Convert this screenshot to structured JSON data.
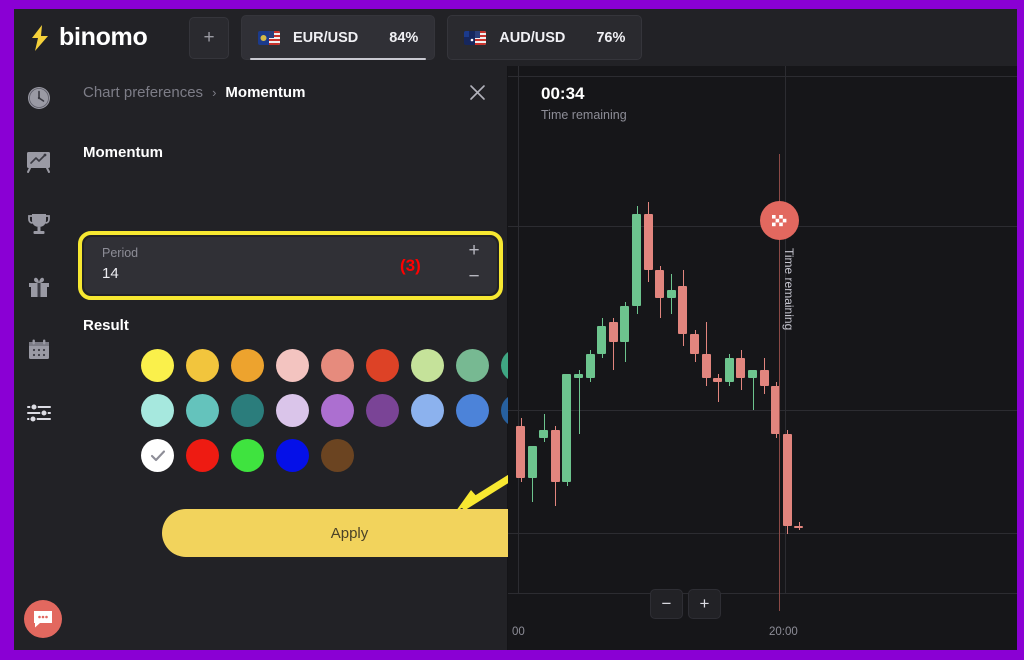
{
  "theme": {
    "frame_color": "#8A00D4",
    "panel_bg": "#222226",
    "chart_bg": "#161619",
    "highlight_yellow": "#F7E831",
    "apply_yellow": "#F2D35C",
    "annotation_red": "#FF0000",
    "bull_green": "#6DC48E",
    "bear_red": "#E2857E"
  },
  "topbar": {
    "logo_text": "binomo",
    "add_tab_label": "+",
    "tabs": [
      {
        "name": "EUR/USD",
        "pct": "84%",
        "active": true,
        "flag": "eu-us-flag-icon"
      },
      {
        "name": "AUD/USD",
        "pct": "76%",
        "active": false,
        "flag": "au-us-flag-icon"
      }
    ]
  },
  "rail": {
    "items": [
      {
        "icon": "clock-icon",
        "name": "sidebar-item-history"
      },
      {
        "icon": "chart-board-icon",
        "name": "sidebar-item-strategies"
      },
      {
        "icon": "trophy-icon",
        "name": "sidebar-item-tournaments"
      },
      {
        "icon": "gift-icon",
        "name": "sidebar-item-gifts"
      },
      {
        "icon": "calendar-icon",
        "name": "sidebar-item-calendar"
      },
      {
        "icon": "sliders-icon",
        "name": "sidebar-item-settings"
      }
    ],
    "chat_icon": "chat-bubble-icon"
  },
  "panel": {
    "breadcrumb_root": "Chart preferences",
    "breadcrumb_sep": "›",
    "breadcrumb_current": "Momentum",
    "close_icon": "close-icon",
    "section_title": "Momentum",
    "period": {
      "label": "Period",
      "value": "14",
      "annotation": "(3)",
      "increment_label": "+",
      "decrement_label": "−"
    },
    "result_title": "Result",
    "swatches": [
      {
        "color": "#FAF04B",
        "selected": false
      },
      {
        "color": "#F2C53D",
        "selected": false
      },
      {
        "color": "#EDA32E",
        "selected": false
      },
      {
        "color": "#F3C4C0",
        "selected": false
      },
      {
        "color": "#E68B7D",
        "selected": false
      },
      {
        "color": "#DD4226",
        "selected": false
      },
      {
        "color": "#C5E29A",
        "selected": false
      },
      {
        "color": "#77B992",
        "selected": false
      },
      {
        "color": "#3FA783",
        "selected": false
      },
      {
        "color": "#A6E8DE",
        "selected": false
      },
      {
        "color": "#64C3BC",
        "selected": false
      },
      {
        "color": "#2B7D7C",
        "selected": false
      },
      {
        "color": "#DAC5EA",
        "selected": false
      },
      {
        "color": "#AC6FD0",
        "selected": false
      },
      {
        "color": "#7A4496",
        "selected": false
      },
      {
        "color": "#8CB2EE",
        "selected": false
      },
      {
        "color": "#4C83D9",
        "selected": false
      },
      {
        "color": "#27609F",
        "selected": false
      },
      {
        "color": "#FFFFFF",
        "selected": true
      },
      {
        "color": "#EE1B12",
        "selected": false
      },
      {
        "color": "#3FE33F",
        "selected": false
      },
      {
        "color": "#0510E8",
        "selected": false
      },
      {
        "color": "#6B4421",
        "selected": false
      }
    ],
    "apply_label": "Apply",
    "arrow_annotation": "arrow-pointing-to-apply"
  },
  "chart_data": {
    "type": "candlestick",
    "title": "",
    "timer_value": "00:34",
    "timer_label": "Time remaining",
    "deal_marker_icon": "checkered-flag-icon",
    "deal_caption": "Time remaining",
    "xlabel": "",
    "ylabel": "",
    "grid": true,
    "x_tick_labels": [
      "00",
      "20:00"
    ],
    "zoom_out_label": "−",
    "zoom_in_label": "+",
    "candles": [
      {
        "o": 60,
        "h": 62,
        "l": 46,
        "c": 47,
        "dir": "down"
      },
      {
        "o": 47,
        "h": 49,
        "l": 41,
        "c": 55,
        "dir": "up"
      },
      {
        "o": 57,
        "h": 63,
        "l": 56,
        "c": 59,
        "dir": "up"
      },
      {
        "o": 59,
        "h": 60,
        "l": 40,
        "c": 46,
        "dir": "down"
      },
      {
        "o": 46,
        "h": 73,
        "l": 45,
        "c": 73,
        "dir": "up"
      },
      {
        "o": 73,
        "h": 74,
        "l": 58,
        "c": 72,
        "dir": "up"
      },
      {
        "o": 72,
        "h": 79,
        "l": 71,
        "c": 78,
        "dir": "up"
      },
      {
        "o": 78,
        "h": 87,
        "l": 77,
        "c": 85,
        "dir": "up"
      },
      {
        "o": 86,
        "h": 87,
        "l": 74,
        "c": 81,
        "dir": "down"
      },
      {
        "o": 81,
        "h": 91,
        "l": 76,
        "c": 90,
        "dir": "up"
      },
      {
        "o": 90,
        "h": 115,
        "l": 88,
        "c": 113,
        "dir": "up"
      },
      {
        "o": 113,
        "h": 116,
        "l": 96,
        "c": 99,
        "dir": "down"
      },
      {
        "o": 99,
        "h": 100,
        "l": 87,
        "c": 92,
        "dir": "down"
      },
      {
        "o": 92,
        "h": 98,
        "l": 88,
        "c": 94,
        "dir": "up"
      },
      {
        "o": 95,
        "h": 99,
        "l": 80,
        "c": 83,
        "dir": "down"
      },
      {
        "o": 83,
        "h": 84,
        "l": 76,
        "c": 78,
        "dir": "down"
      },
      {
        "o": 78,
        "h": 86,
        "l": 70,
        "c": 72,
        "dir": "down"
      },
      {
        "o": 72,
        "h": 73,
        "l": 66,
        "c": 71,
        "dir": "down"
      },
      {
        "o": 71,
        "h": 78,
        "l": 70,
        "c": 77,
        "dir": "up"
      },
      {
        "o": 77,
        "h": 79,
        "l": 69,
        "c": 72,
        "dir": "down"
      },
      {
        "o": 72,
        "h": 73,
        "l": 64,
        "c": 74,
        "dir": "up"
      },
      {
        "o": 74,
        "h": 77,
        "l": 68,
        "c": 70,
        "dir": "down"
      },
      {
        "o": 70,
        "h": 71,
        "l": 57,
        "c": 58,
        "dir": "down"
      },
      {
        "o": 58,
        "h": 59,
        "l": 33,
        "c": 35,
        "dir": "down"
      },
      {
        "o": 35,
        "h": 36,
        "l": 34,
        "c": 35,
        "dir": "down"
      }
    ]
  }
}
